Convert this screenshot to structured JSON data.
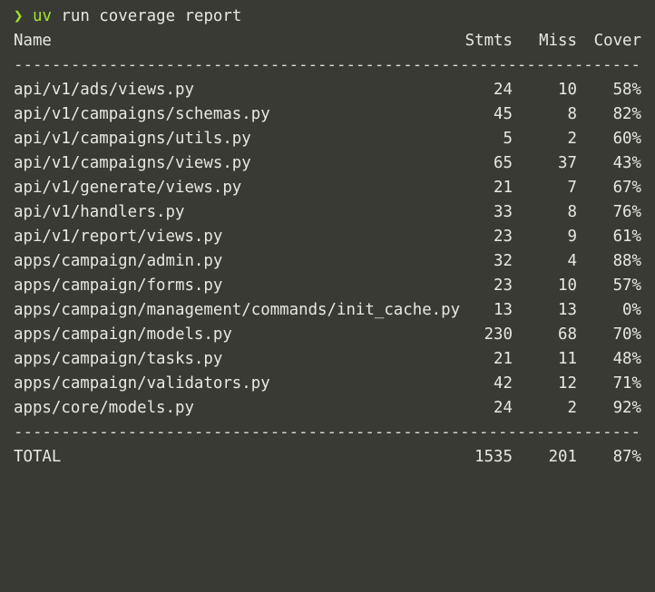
{
  "prompt": {
    "symbol": "❯",
    "program": "uv",
    "args": "run coverage report"
  },
  "header": {
    "name": "Name",
    "stmts": "Stmts",
    "miss": "Miss",
    "cover": "Cover"
  },
  "divider": "------------------------------------------------------------------",
  "rows": [
    {
      "name": "api/v1/ads/views.py",
      "stmts": "24",
      "miss": "10",
      "cover": "58%"
    },
    {
      "name": "api/v1/campaigns/schemas.py",
      "stmts": "45",
      "miss": "8",
      "cover": "82%"
    },
    {
      "name": "api/v1/campaigns/utils.py",
      "stmts": "5",
      "miss": "2",
      "cover": "60%"
    },
    {
      "name": "api/v1/campaigns/views.py",
      "stmts": "65",
      "miss": "37",
      "cover": "43%"
    },
    {
      "name": "api/v1/generate/views.py",
      "stmts": "21",
      "miss": "7",
      "cover": "67%"
    },
    {
      "name": "api/v1/handlers.py",
      "stmts": "33",
      "miss": "8",
      "cover": "76%"
    },
    {
      "name": "api/v1/report/views.py",
      "stmts": "23",
      "miss": "9",
      "cover": "61%"
    },
    {
      "name": "apps/campaign/admin.py",
      "stmts": "32",
      "miss": "4",
      "cover": "88%"
    },
    {
      "name": "apps/campaign/forms.py",
      "stmts": "23",
      "miss": "10",
      "cover": "57%"
    },
    {
      "name": "apps/campaign/management/commands/init_cache.py",
      "stmts": "13",
      "miss": "13",
      "cover": "0%"
    },
    {
      "name": "apps/campaign/models.py",
      "stmts": "230",
      "miss": "68",
      "cover": "70%"
    },
    {
      "name": "apps/campaign/tasks.py",
      "stmts": "21",
      "miss": "11",
      "cover": "48%"
    },
    {
      "name": "apps/campaign/validators.py",
      "stmts": "42",
      "miss": "12",
      "cover": "71%"
    },
    {
      "name": "apps/core/models.py",
      "stmts": "24",
      "miss": "2",
      "cover": "92%"
    }
  ],
  "total": {
    "name": "TOTAL",
    "stmts": "1535",
    "miss": "201",
    "cover": "87%"
  },
  "colors": {
    "background": "#3a3a35",
    "text": "#e8e8e2",
    "prompt": "#a6e22e"
  }
}
